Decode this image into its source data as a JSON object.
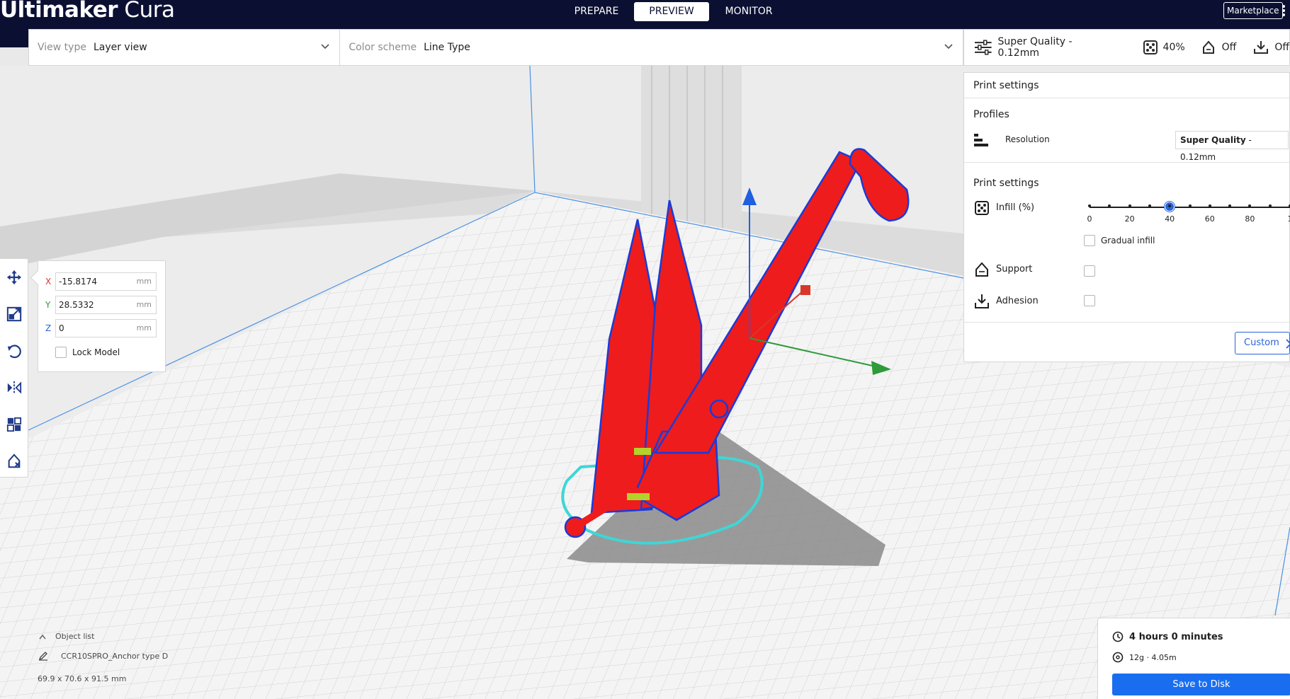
{
  "app": {
    "logo_bold": "Ultimaker",
    "logo_light": "Cura"
  },
  "stages": {
    "prepare": "PREPARE",
    "preview": "PREVIEW",
    "monitor": "MONITOR",
    "active": "PREVIEW"
  },
  "header": {
    "marketplace": "Marketplace"
  },
  "viewbar": {
    "view_type_label": "View type",
    "view_type_value": "Layer view",
    "color_scheme_label": "Color scheme",
    "color_scheme_value": "Line Type"
  },
  "settings_summary": {
    "profile": "Super Quality - 0.12mm",
    "infill": "40%",
    "support": "Off",
    "adhesion": "Off"
  },
  "move_panel": {
    "x_label": "X",
    "x_value": "-15.8174",
    "y_label": "Y",
    "y_value": "28.5332",
    "z_label": "Z",
    "z_value": "0",
    "unit": "mm",
    "lock_label": "Lock Model",
    "lock_checked": false
  },
  "print_settings": {
    "title": "Print settings",
    "profiles_heading": "Profiles",
    "resolution_label": "Resolution",
    "resolution_value_bold": "Super Quality",
    "resolution_value_rest": " - 0.12mm",
    "settings_heading": "Print settings",
    "infill_label": "Infill (%)",
    "infill_value": 40,
    "infill_ticks": [
      "0",
      "20",
      "40",
      "60",
      "80",
      "1"
    ],
    "gradual_infill_label": "Gradual infill",
    "gradual_infill_checked": false,
    "support_label": "Support",
    "support_checked": false,
    "adhesion_label": "Adhesion",
    "adhesion_checked": false,
    "custom_button": "Custom"
  },
  "object_list": {
    "toggle_label": "Object list",
    "object_name": "CCR10SPRO_Anchor type D",
    "dimensions": "69.9 x 70.6 x 91.5 mm"
  },
  "output": {
    "print_time": "4 hours 0 minutes",
    "material": "12g · 4.05m",
    "save_button": "Save to Disk"
  },
  "colors": {
    "header_bg": "#0b1033",
    "accent_blue": "#196ef0",
    "model_red": "#ee1c1c",
    "skirt_cyan": "#3fd6d6"
  }
}
